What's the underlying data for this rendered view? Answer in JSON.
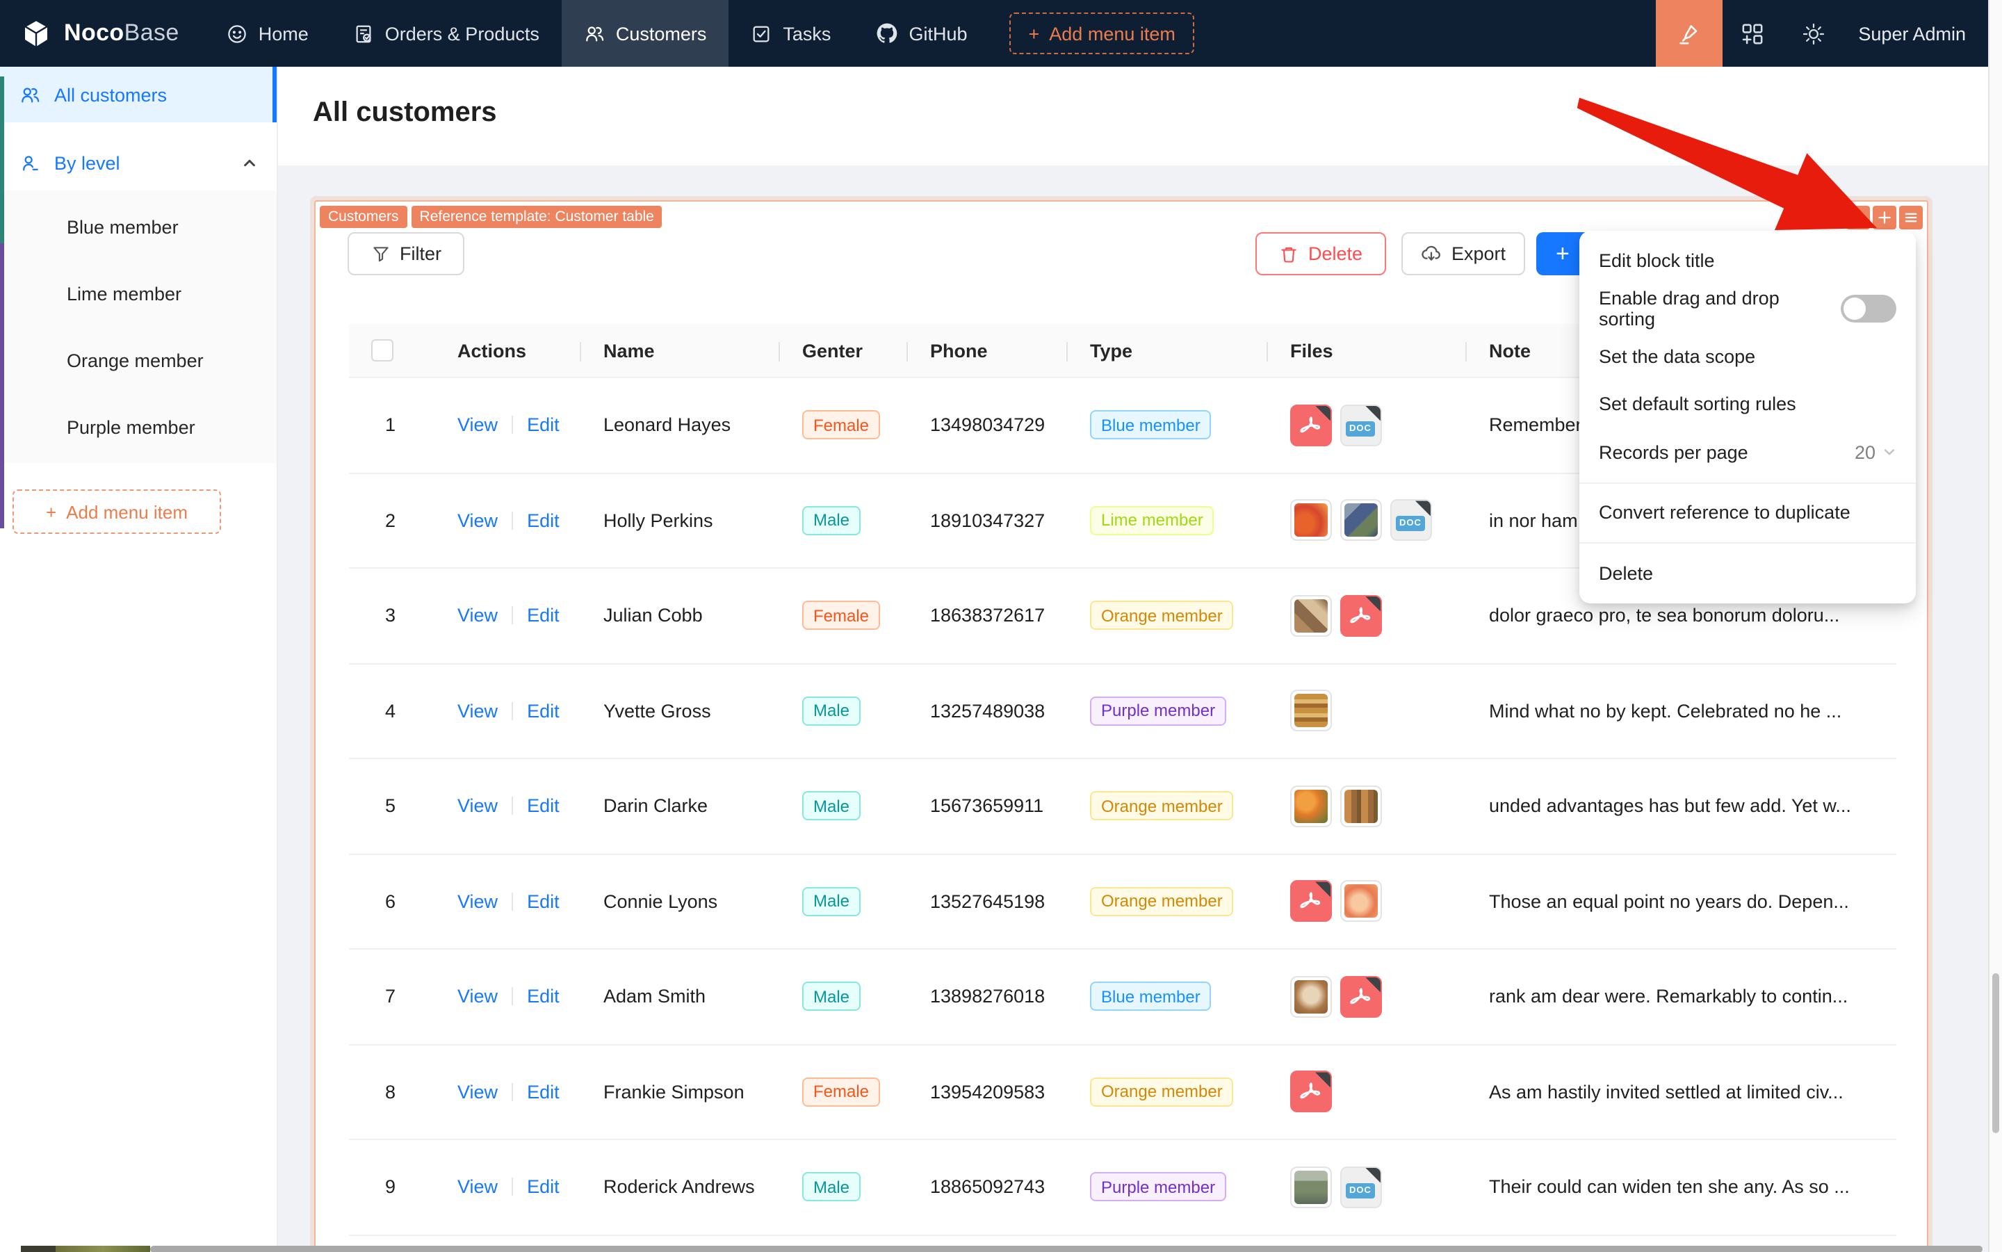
{
  "navbar": {
    "logo_noco": "Noco",
    "logo_base": "Base",
    "items": [
      {
        "label": "Home"
      },
      {
        "label": "Orders & Products"
      },
      {
        "label": "Customers"
      },
      {
        "label": "Tasks"
      },
      {
        "label": "GitHub"
      }
    ],
    "add_menu_item": "Add menu item",
    "user": "Super Admin"
  },
  "sidebar": {
    "all_customers": "All customers",
    "by_level": "By level",
    "levels": [
      {
        "label": "Blue member"
      },
      {
        "label": "Lime member"
      },
      {
        "label": "Orange member"
      },
      {
        "label": "Purple member"
      }
    ],
    "add_menu_item": "Add menu item"
  },
  "page": {
    "title": "All customers"
  },
  "block": {
    "chip_collection": "Customers",
    "chip_template": "Reference template: Customer table",
    "toolbar": {
      "filter": "Filter",
      "delete": "Delete",
      "export": "Export",
      "add_new": "+"
    }
  },
  "menu": {
    "edit_block_title": "Edit block title",
    "drag_sort": "Enable drag and drop sorting",
    "data_scope": "Set the data scope",
    "sorting_rules": "Set default sorting rules",
    "records_per_page": "Records per page",
    "records_value": "20",
    "convert": "Convert reference to duplicate",
    "delete": "Delete"
  },
  "labels": {
    "doc_badge": "DOC"
  },
  "table": {
    "columns": [
      "Actions",
      "Name",
      "Genter",
      "Phone",
      "Type",
      "Files",
      "Note"
    ],
    "actions": {
      "view": "View",
      "edit": "Edit"
    },
    "rows": [
      {
        "index": "1",
        "name": "Leonard Hayes",
        "gender": {
          "label": "Female",
          "key": "volcano"
        },
        "phone": "13498034729",
        "type": {
          "label": "Blue member",
          "key": "blue"
        },
        "files": [
          "pdf",
          "doc"
        ],
        "note": "Remember"
      },
      {
        "index": "2",
        "name": "Holly Perkins",
        "gender": {
          "label": "Male",
          "key": "cyan"
        },
        "phone": "18910347327",
        "type": {
          "label": "Lime member",
          "key": "lime"
        },
        "files": [
          "img:fruit",
          "img:grapes",
          "doc"
        ],
        "note": "in nor ham"
      },
      {
        "index": "3",
        "name": "Julian Cobb",
        "gender": {
          "label": "Female",
          "key": "volcano"
        },
        "phone": "18638372617",
        "type": {
          "label": "Orange member",
          "key": "gold"
        },
        "files": [
          "img:market",
          "pdf"
        ],
        "note": "dolor graeco pro, te sea bonorum doloru..."
      },
      {
        "index": "4",
        "name": "Yvette Gross",
        "gender": {
          "label": "Male",
          "key": "cyan"
        },
        "phone": "13257489038",
        "type": {
          "label": "Purple member",
          "key": "purple"
        },
        "files": [
          "img:cookies"
        ],
        "note": "Mind what no by kept. Celebrated no he ..."
      },
      {
        "index": "5",
        "name": "Darin Clarke",
        "gender": {
          "label": "Male",
          "key": "cyan"
        },
        "phone": "15673659911",
        "type": {
          "label": "Orange member",
          "key": "gold"
        },
        "files": [
          "img:oranges",
          "img:oranges2"
        ],
        "note": "unded advantages has but few add. Yet w..."
      },
      {
        "index": "6",
        "name": "Connie Lyons",
        "gender": {
          "label": "Male",
          "key": "cyan"
        },
        "phone": "13527645198",
        "type": {
          "label": "Orange member",
          "key": "gold"
        },
        "files": [
          "pdf",
          "img:peach"
        ],
        "note": "Those an equal point no years do. Depen..."
      },
      {
        "index": "7",
        "name": "Adam Smith",
        "gender": {
          "label": "Male",
          "key": "cyan"
        },
        "phone": "13898276018",
        "type": {
          "label": "Blue member",
          "key": "blue"
        },
        "files": [
          "img:coffee",
          "pdf"
        ],
        "note": "rank am dear were. Remarkably to contin..."
      },
      {
        "index": "8",
        "name": "Frankie Simpson",
        "gender": {
          "label": "Female",
          "key": "volcano"
        },
        "phone": "13954209583",
        "type": {
          "label": "Orange member",
          "key": "gold"
        },
        "files": [
          "pdf"
        ],
        "note": "As am hastily invited settled at limited civ..."
      },
      {
        "index": "9",
        "name": "Roderick Andrews",
        "gender": {
          "label": "Male",
          "key": "cyan"
        },
        "phone": "18865092743",
        "type": {
          "label": "Purple member",
          "key": "purple"
        },
        "files": [
          "img:store",
          "doc"
        ],
        "note": "Their could can widen ten she any. As so ..."
      }
    ]
  },
  "colors": {
    "accent": "#ee845f",
    "navbar": "#0e1f33",
    "link": "#1677ff",
    "arrow": "#e81c0d",
    "active_sidebar_bg": "#e6f4ff"
  }
}
